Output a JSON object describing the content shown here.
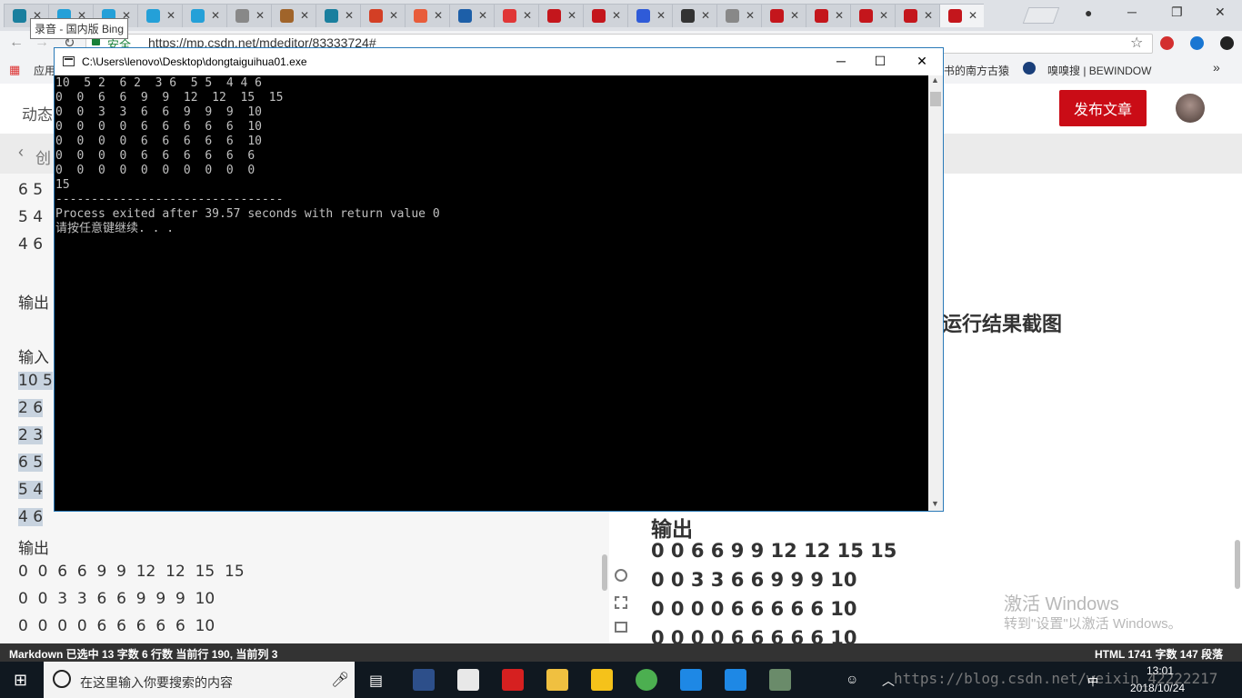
{
  "browser": {
    "tooltip": "录音 - 国内版 Bing",
    "security_label": "安全",
    "url": "https://mp.csdn.net/mdeditor/83333724#",
    "apps_label": "应用",
    "bookmark_1": "书的南方古猿",
    "bookmark_2": "嗅嗅搜 | BEWINDOW",
    "more_bookmarks": "»",
    "tab_icons": [
      "bing-icon",
      "bilibili-icon",
      "bilibili-icon",
      "bilibili-icon",
      "bilibili-icon",
      "script-icon",
      "acorn-icon",
      "bing-icon",
      "colorful-icon",
      "jian-icon",
      "blue-icon",
      "red-icon",
      "csdn-icon",
      "csdn-icon",
      "baidu-icon",
      "bracket-icon",
      "script-icon",
      "csdn-icon",
      "csdn-icon",
      "csdn-icon",
      "csdn-icon",
      "csdn-icon"
    ],
    "tab_icon_colors": [
      "#1a7f9e",
      "#24a0d8",
      "#24a0d8",
      "#24a0d8",
      "#24a0d8",
      "#888888",
      "#a0642a",
      "#1a7f9e",
      "#d33f25",
      "#e85c3a",
      "#1d5fa8",
      "#e03636",
      "#c4161c",
      "#c4161c",
      "#2f5bd8",
      "#333333",
      "#888888",
      "#c4161c",
      "#c4161c",
      "#c4161c",
      "#c4161c",
      "#c4161c"
    ]
  },
  "editor": {
    "tab_dynamic": "动态",
    "back_label": "创",
    "publish_button": "发布文章",
    "left_lines": [
      "6 5",
      "5 4",
      "4 6",
      "",
      "输出",
      "",
      "输入",
      "10 5",
      "2 6",
      "2 3",
      "6 5",
      "5 4",
      "4 6",
      "输出",
      "0  0  6  6  9  9  12  12  15  15",
      "0  0  3  3  6  6  9  9  9  10",
      "0  0  0  0  6  6  6  6  6  10"
    ],
    "preview_heading": "运行结果截图",
    "preview_output_label": "输出",
    "preview_lines": [
      "0 0 6 6 9 9 12 12 15 15",
      "0 0 3 3 6 6 9 9 9 10",
      "0 0 0 0 6 6 6 6 6 10",
      "0 0 0 0 6 6 6 6 6 10"
    ],
    "activate_title": "激活 Windows",
    "activate_sub": "转到\"设置\"以激活 Windows。"
  },
  "statusbar": {
    "left": "Markdown 已选中  13 字数  6 行数  当前行 190, 当前列 3",
    "right": "HTML  1741 字数  147 段落"
  },
  "console": {
    "title": "C:\\Users\\lenovo\\Desktop\\dongtaiguihua01.exe",
    "lines": [
      "10  5 2  6 2  3 6  5 5  4 4 6",
      "0  0  6  6  9  9  12  12  15  15",
      "0  0  3  3  6  6  9  9  9  10",
      "0  0  0  0  6  6  6  6  6  10",
      "0  0  0  0  6  6  6  6  6  10",
      "0  0  0  0  6  6  6  6  6  6",
      "0  0  0  0  0  0  0  0  0  0",
      "15",
      "--------------------------------",
      "Process exited after 39.57 seconds with return value 0",
      "请按任意键继续. . ."
    ]
  },
  "taskbar": {
    "search_placeholder": "在这里输入你要搜索的内容",
    "ime": "中",
    "time": "13:01",
    "date": "2018/10/24",
    "watermark": "https://blog.csdn.net/weixin_42222217",
    "app_icons": [
      "dev-cpp-icon",
      "media-icon",
      "youdao-icon",
      "folder-icon",
      "video-icon",
      "chrome-icon",
      "edge-icon",
      "writer-icon",
      "console-icon"
    ],
    "app_colors": [
      "#2d4f8a",
      "#e8e8e8",
      "#d62020",
      "#f0c040",
      "#f5c21a",
      "#4caf50",
      "#1e88e5",
      "#1e88e5",
      "#6a8b6a"
    ]
  }
}
